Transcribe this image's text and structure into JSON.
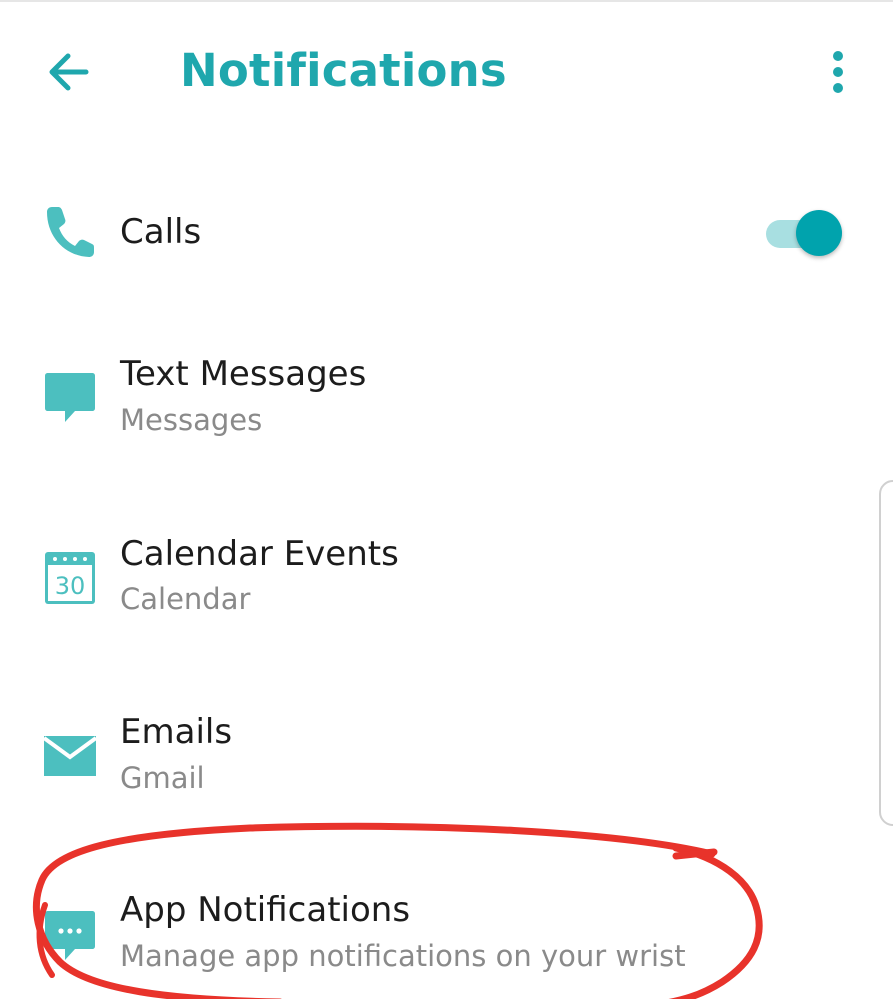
{
  "header": {
    "title": "Notifications",
    "back_icon": "arrow-left-icon",
    "menu_icon": "more-vert-icon"
  },
  "colors": {
    "accent": "#1fa7ad",
    "toggle_on": "#00a3ad",
    "annotation": "#e8332b"
  },
  "items": [
    {
      "icon": "phone-icon",
      "title": "Calls",
      "subtitle": "",
      "toggle": true
    },
    {
      "icon": "message-icon",
      "title": "Text Messages",
      "subtitle": "Messages"
    },
    {
      "icon": "calendar-icon",
      "title": "Calendar Events",
      "subtitle": "Calendar",
      "icon_text": "30"
    },
    {
      "icon": "mail-icon",
      "title": "Emails",
      "subtitle": "Gmail"
    },
    {
      "icon": "chat-dots-icon",
      "title": "App Notifications",
      "subtitle": "Manage app notifications on your wrist"
    }
  ]
}
